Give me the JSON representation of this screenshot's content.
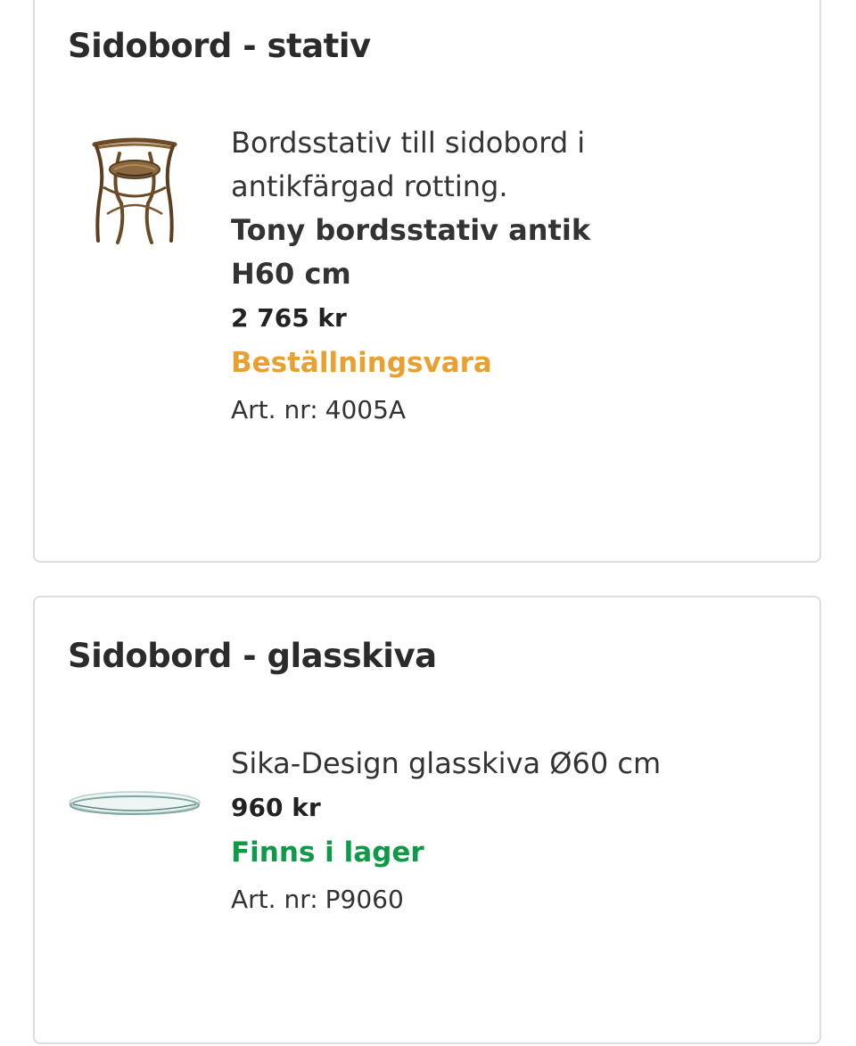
{
  "products": [
    {
      "section_title": "Sidobord - stativ",
      "image_icon": "rattan-table-base-image",
      "description": "Bordsstativ till sidobord i antikfärgad rotting.",
      "name": "Tony bordsstativ antik H60 cm",
      "price": "2 765 kr",
      "stock_status": "Beställningsvara",
      "stock_color": "#e8a030",
      "art_nr_label": "Art. nr:",
      "art_nr": "4005A"
    },
    {
      "section_title": "Sidobord - glasskiva",
      "image_icon": "glass-tabletop-image",
      "name": "Sika-Design glasskiva Ø60 cm",
      "price": "960 kr",
      "stock_status": "Finns i lager",
      "stock_color": "#109948",
      "art_nr_label": "Art. nr:",
      "art_nr": "P9060"
    }
  ],
  "colors": {
    "card_border": "#dddddd",
    "text": "#333333"
  }
}
